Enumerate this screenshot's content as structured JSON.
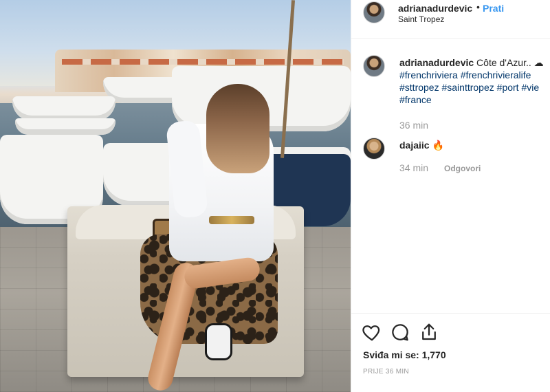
{
  "header": {
    "username": "adrianadurdevic",
    "separator": "•",
    "follow_label": "Prati",
    "location": "Saint Tropez"
  },
  "caption": {
    "username": "adrianadurdevic",
    "text": "Côte d'Azur.. ☁",
    "hashtags": [
      "#frenchriviera",
      "#frenchrivieralife",
      "#sttropez",
      "#sainttropez",
      "#port",
      "#vie",
      "#france"
    ],
    "time": "36 min"
  },
  "comments": [
    {
      "username": "dajaiic",
      "text": "🔥",
      "time": "34 min",
      "reply_label": "Odgovori"
    }
  ],
  "actions": {
    "like_icon": "heart-icon",
    "comment_icon": "comment-icon",
    "share_icon": "share-icon",
    "likes_text": "Sviđa mi se: 1,770",
    "posted_time": "PRIJE 36 MIN"
  }
}
